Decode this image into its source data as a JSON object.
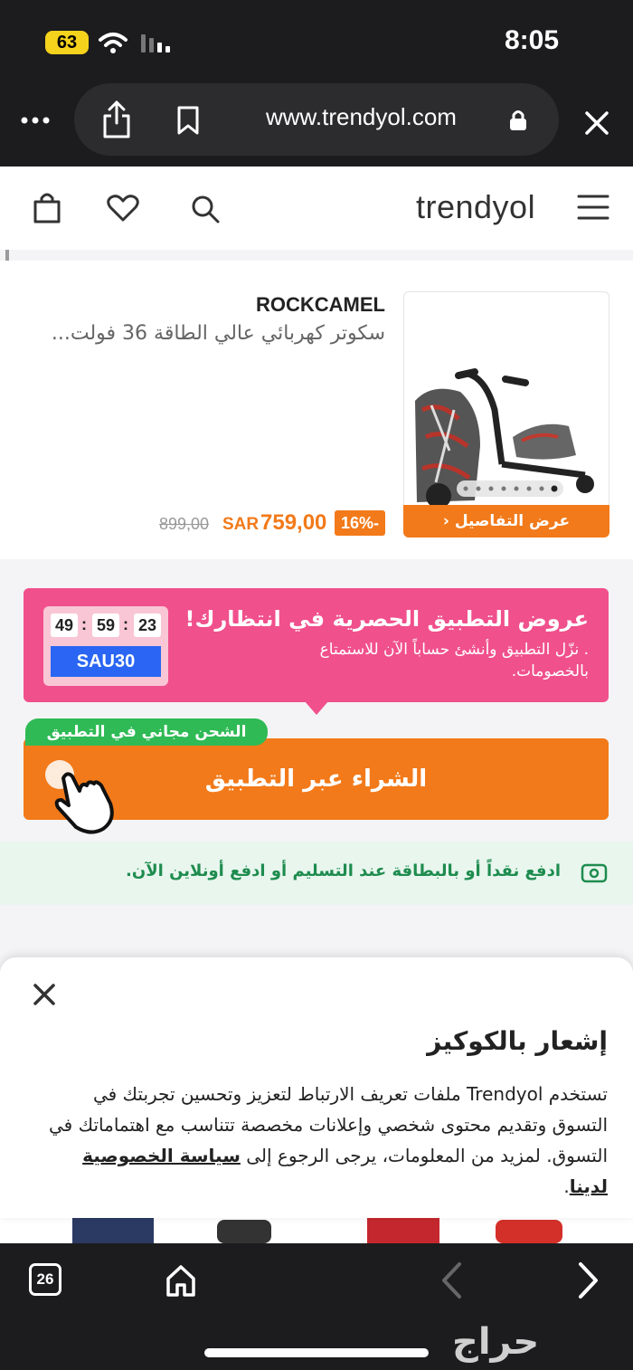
{
  "status_bar": {
    "battery": "63",
    "time": "8:05"
  },
  "browser": {
    "url": "www.trendyol.com"
  },
  "header": {
    "logo": "trendyol"
  },
  "product": {
    "brand": "ROCKCAMEL",
    "title": "سكوتر كهربائي عالي الطاقة 36 فولت...",
    "details_label": "عرض التفاصيل",
    "discount": "16%-",
    "price": "759,00",
    "currency": "SAR",
    "old_price": "899,00",
    "image_dots": 8,
    "active_dot": 8
  },
  "promo": {
    "title": "عروض التطبيق الحصرية في انتظارك!",
    "subtitle": ". نزّل التطبيق وأنشئ حساباً الآن للاستمتاع بالخصومات.",
    "timer": {
      "hours": "23",
      "minutes": "59",
      "seconds": "49"
    },
    "coupon_code": "SAU30"
  },
  "cta": {
    "free_shipping": "الشحن مجاني في التطبيق",
    "buy_label": "الشراء عبر التطبيق"
  },
  "payment": {
    "text": "ادفع نقداً أو بالبطاقة عند التسليم أو ادفع أونلاين الآن."
  },
  "cookie": {
    "title": "إشعار بالكوكيز",
    "body": "تستخدم Trendyol ملفات تعريف الارتباط لتعزيز وتحسين تجربتك في التسوق وتقديم محتوى شخصي وإعلانات مخصصة تتناسب مع اهتماماتك في التسوق. لمزيد من المعلومات، يرجى الرجوع إلى",
    "link": "سياسة الخصوصية لدينا",
    "link_suffix": "."
  },
  "toolbar": {
    "tab_count": "26"
  },
  "watermark": "حراج",
  "colors": {
    "orange": "#f27a1a",
    "pink": "#f0508c",
    "green": "#2fba55",
    "blue": "#2a66f3"
  }
}
